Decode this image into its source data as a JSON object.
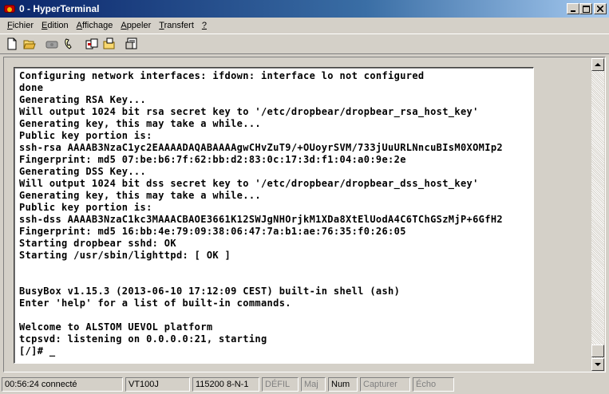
{
  "window": {
    "title": "0 - HyperTerminal",
    "controls": {
      "minimize": "_",
      "maximize": "□",
      "close": "✕"
    }
  },
  "menu": [
    {
      "label": "Fichier"
    },
    {
      "label": "Edition"
    },
    {
      "label": "Affichage"
    },
    {
      "label": "Appeler"
    },
    {
      "label": "Transfert"
    },
    {
      "label": "?"
    }
  ],
  "toolbar": {
    "icons": [
      "new-document-icon",
      "open-folder-icon",
      "disconnect-icon",
      "call-icon",
      "send-icon",
      "receive-icon",
      "properties-icon"
    ]
  },
  "terminal": {
    "lines": [
      "Configuring network interfaces: ifdown: interface lo not configured",
      "done",
      "Generating RSA Key...",
      "Will output 1024 bit rsa secret key to '/etc/dropbear/dropbear_rsa_host_key'",
      "Generating key, this may take a while...",
      "Public key portion is:",
      "ssh-rsa AAAAB3NzaC1yc2EAAAADAQABAAAAgwCHvZuT9/+OUoyrSVM/733jUuURLNncuBIsM0XOMIp2",
      "Fingerprint: md5 07:be:b6:7f:62:bb:d2:83:0c:17:3d:f1:04:a0:9e:2e",
      "Generating DSS Key...",
      "Will output 1024 bit dss secret key to '/etc/dropbear/dropbear_dss_host_key'",
      "Generating key, this may take a while...",
      "Public key portion is:",
      "ssh-dss AAAAB3NzaC1kc3MAAACBAOE3661K12SWJgNHOrjkM1XDa8XtElUodA4C6TChGSzMjP+6GfH2",
      "Fingerprint: md5 16:bb:4e:79:09:38:06:47:7a:b1:ae:76:35:f0:26:05",
      "Starting dropbear sshd: OK",
      "Starting /usr/sbin/lighttpd: [ OK ]",
      "",
      "",
      "BusyBox v1.15.3 (2013-06-10 17:12:09 CEST) built-in shell (ash)",
      "Enter 'help' for a list of built-in commands.",
      "",
      "Welcome to ALSTOM UEVOL platform",
      "tcpsvd: listening on 0.0.0.0:21, starting",
      "[/]# _"
    ]
  },
  "status": {
    "connection": "00:56:24 connecté",
    "emulation": "VT100J",
    "settings": "115200 8-N-1",
    "scroll": "DÉFIL",
    "caps": "Maj",
    "num": "Num",
    "capture": "Capturer",
    "echo": "Écho"
  }
}
